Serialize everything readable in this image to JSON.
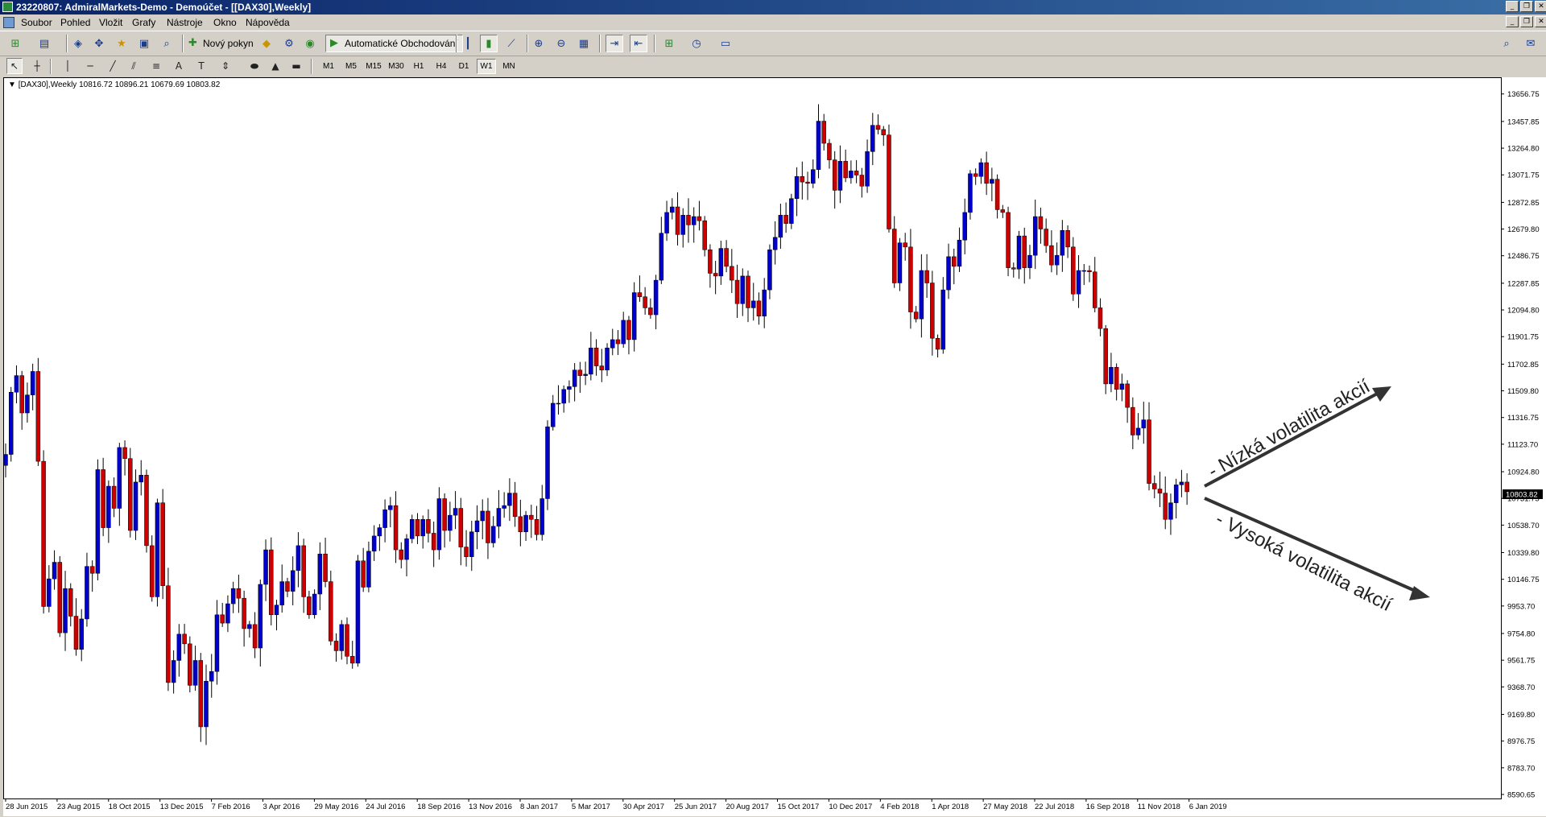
{
  "window": {
    "title": "23220807: AdmiralMarkets-Demo - Demoúčet - [[DAX30],Weekly]"
  },
  "menu": {
    "items": [
      "Soubor",
      "Pohled",
      "Vložit",
      "Grafy",
      "Nástroje",
      "Okno",
      "Nápověda"
    ]
  },
  "toolbar": {
    "new_order_label": "Nový pokyn",
    "auto_trading_label": "Automatické Obchodování"
  },
  "timeframes": [
    "M1",
    "M5",
    "M15",
    "M30",
    "H1",
    "H4",
    "D1",
    "W1",
    "MN"
  ],
  "active_timeframe": "W1",
  "chart": {
    "info": "[DAX30],Weekly  10816.72 10896.21 10679.69 10803.82",
    "current_price_label": "10803.82",
    "annotation_low": "- Nízká volatilita akcií",
    "annotation_high": "- Vysoká volatilita akcií",
    "colors": {
      "bull": "#0000cc",
      "bear": "#cc0000",
      "wick": "#000000",
      "bg": "#ffffff",
      "price_box": "#000000"
    }
  },
  "chart_data": {
    "type": "candlestick",
    "ylim": [
      8590.65,
      13760
    ],
    "yticks": [
      "13656.75",
      "13457.85",
      "13264.80",
      "13071.75",
      "12872.85",
      "12679.80",
      "12486.75",
      "12287.85",
      "12094.80",
      "11901.75",
      "11702.85",
      "11509.80",
      "11316.75",
      "11123.70",
      "10924.80",
      "10731.75",
      "10538.70",
      "10339.80",
      "10146.75",
      "9953.70",
      "9754.80",
      "9561.75",
      "9368.70",
      "9169.80",
      "8976.75",
      "8783.70",
      "8590.65"
    ],
    "xticks": [
      "28 Jun 2015",
      "23 Aug 2015",
      "18 Oct 2015",
      "13 Dec 2015",
      "7 Feb 2016",
      "3 Apr 2016",
      "29 May 2016",
      "24 Jul 2016",
      "18 Sep 2016",
      "13 Nov 2016",
      "8 Jan 2017",
      "5 Mar 2017",
      "30 Apr 2017",
      "25 Jun 2017",
      "20 Aug 2017",
      "15 Oct 2017",
      "10 Dec 2017",
      "4 Feb 2018",
      "1 Apr 2018",
      "27 May 2018",
      "22 Jul 2018",
      "16 Sep 2018",
      "11 Nov 2018",
      "6 Jan 2019"
    ],
    "weekly_closes": [
      11050,
      11500,
      11620,
      11350,
      11480,
      11650,
      11000,
      9950,
      10150,
      10270,
      9760,
      10080,
      9880,
      9640,
      9860,
      10240,
      10190,
      10940,
      10520,
      10820,
      10660,
      11100,
      11020,
      10500,
      10850,
      10900,
      10390,
      10020,
      10700,
      10100,
      9400,
      9560,
      9750,
      9680,
      9380,
      9560,
      9080,
      9410,
      9480,
      9890,
      9830,
      9970,
      10080,
      10010,
      9790,
      9820,
      9650,
      10110,
      10360,
      9890,
      9960,
      10130,
      10060,
      10210,
      10390,
      10020,
      9890,
      10040,
      10330,
      10130,
      9700,
      9630,
      9820,
      9590,
      9540,
      10280,
      10090,
      10350,
      10460,
      10520,
      10650,
      10680,
      10360,
      10290,
      10440,
      10580,
      10460,
      10580,
      10480,
      10360,
      10730,
      10500,
      10610,
      10660,
      10380,
      10310,
      10490,
      10570,
      10640,
      10410,
      10530,
      10660,
      10680,
      10770,
      10600,
      10490,
      10610,
      10580,
      10470,
      10730,
      11250,
      11420,
      11420,
      11520,
      11540,
      11660,
      11620,
      11630,
      11820,
      11690,
      11660,
      11820,
      11880,
      11850,
      12020,
      11880,
      12220,
      12190,
      12110,
      12060,
      12310,
      12650,
      12800,
      12840,
      12640,
      12780,
      12710,
      12770,
      12740,
      12530,
      12360,
      12340,
      12540,
      12410,
      12310,
      12140,
      12340,
      12110,
      12160,
      12050,
      12240,
      12530,
      12620,
      12780,
      12720,
      12900,
      13060,
      13020,
      13010,
      13110,
      13460,
      13300,
      13180,
      12960,
      13170,
      13050,
      13100,
      13070,
      12990,
      13240,
      13430,
      13400,
      13360,
      12680,
      12290,
      12580,
      12550,
      12080,
      12030,
      12380,
      12290,
      11890,
      11810,
      12240,
      12480,
      12410,
      12600,
      12800,
      13080,
      13060,
      13160,
      13010,
      13040,
      12820,
      12800,
      12400,
      12390,
      12630,
      12400,
      12490,
      12770,
      12680,
      12560,
      12420,
      12490,
      12670,
      12550,
      12210,
      12380,
      12380,
      12370,
      12110,
      11960,
      11560,
      11680,
      11520,
      11560,
      11390,
      11190,
      11240,
      11300,
      10840,
      10800,
      10770,
      10580,
      10700,
      10830,
      10850,
      10780
    ]
  }
}
